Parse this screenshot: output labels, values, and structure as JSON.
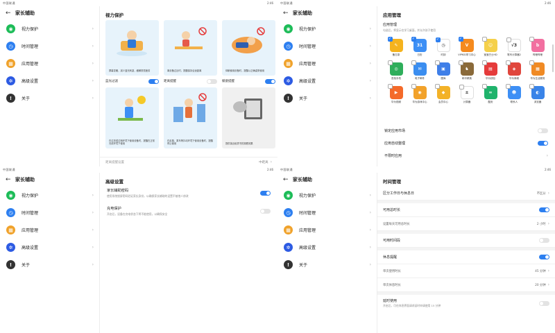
{
  "status": {
    "left": "中国联通",
    "time": "2:46"
  },
  "nav": {
    "header_title": "家长辅助",
    "items": [
      {
        "label": "视力保护",
        "icon": "eye-icon"
      },
      {
        "label": "时间管理",
        "icon": "clock-icon"
      },
      {
        "label": "应用管理",
        "icon": "grid-icon"
      },
      {
        "label": "高级设置",
        "icon": "gear-icon"
      },
      {
        "label": "关于",
        "icon": "info-icon"
      }
    ]
  },
  "vision": {
    "title": "视力保护",
    "cards": [
      {
        "text": "屏幕变暖，减少蓝光刺激，缓解视觉疲劳"
      },
      {
        "text": "离设备过近时，提醒保持合适距离"
      },
      {
        "text": "仰躺使用设备时，提醒以正确姿势使用"
      },
      {
        "text": "在过亮或过暗环境下使用设备时，提醒在正常光线环境下使用"
      },
      {
        "text": "在走路、乘车等抖动环境下使用设备时，提醒停止使用"
      },
      {
        "text": "提供接近纸质书的观看效果"
      }
    ],
    "toggles": [
      {
        "label": "蓝光过滤",
        "on": true
      },
      {
        "label": "距离提醒",
        "on": false
      },
      {
        "label": "躺姿提醒",
        "on": true
      }
    ],
    "distance_setting": {
      "label": "距离提醒设置",
      "value": "中距离"
    }
  },
  "apps": {
    "title": "应用管理",
    "sub_title": "应用管理",
    "sub_desc": "勾选后，将显示在学习桌面，并允许孩子使用",
    "items": [
      {
        "name": "备忘录",
        "color": "#f5b31e",
        "checked": true,
        "glyph": "✎"
      },
      {
        "name": "日历",
        "color": "#3d8ff5",
        "checked": true,
        "glyph": "31"
      },
      {
        "name": "时钟",
        "color": "#ffffff",
        "checked": true,
        "glyph": "◷"
      },
      {
        "name": "VIPKID学习中心",
        "color": "#f58a1e",
        "checked": true,
        "glyph": "V"
      },
      {
        "name": "宝宝巴士HD",
        "color": "#f5d04a",
        "checked": false,
        "glyph": "☺"
      },
      {
        "name": "笔写计算器2",
        "color": "#ffffff",
        "checked": false,
        "glyph": "√3"
      },
      {
        "name": "哔哩哔哩",
        "color": "#f26fa0",
        "checked": false,
        "glyph": "b"
      },
      {
        "name": "查找手机",
        "color": "#2fae5b",
        "checked": false,
        "glyph": "◎"
      },
      {
        "name": "电子邮件",
        "color": "#3b8ef0",
        "checked": false,
        "glyph": "✉"
      },
      {
        "name": "图库",
        "color": "#3f7fe8",
        "checked": false,
        "glyph": "▣"
      },
      {
        "name": "和平精英",
        "color": "#8a6a3a",
        "checked": false,
        "glyph": "♞"
      },
      {
        "name": "华为钱包",
        "color": "#e53b3b",
        "checked": false,
        "glyph": "▤"
      },
      {
        "name": "华为商城",
        "color": "#e0463c",
        "checked": false,
        "glyph": "◈"
      },
      {
        "name": "华为生活服务",
        "color": "#f08a24",
        "checked": false,
        "glyph": "▦"
      },
      {
        "name": "华为视频",
        "color": "#f46a2a",
        "checked": false,
        "glyph": "▶"
      },
      {
        "name": "华为游戏中心",
        "color": "#f2a22a",
        "checked": false,
        "glyph": "◉"
      },
      {
        "name": "会员中心",
        "color": "#f3b228",
        "checked": false,
        "glyph": "◆"
      },
      {
        "name": "计算器",
        "color": "#ffffff",
        "checked": false,
        "glyph": "±"
      },
      {
        "name": "酷安",
        "color": "#1fb36c",
        "checked": false,
        "glyph": "∞"
      },
      {
        "name": "联系人",
        "color": "#3d8ff5",
        "checked": false,
        "glyph": "☻"
      },
      {
        "name": "浏览器",
        "color": "#3a84e8",
        "checked": false,
        "glyph": "◐"
      }
    ],
    "rows": [
      {
        "label": "锁定应用市场",
        "on": false
      },
      {
        "label": "应用自动整理",
        "on": true
      }
    ],
    "unlimited": {
      "label": "不限时应用"
    }
  },
  "advanced": {
    "title": "高级设置",
    "items": [
      {
        "title": "家长辅助密码",
        "desc": "使用系统锁屏密码验证家长身份，以确保家长辅助的设置不被他人修改",
        "on": true
      },
      {
        "title": "充电保护",
        "desc": "开启后，设备在充电状态下将不能使用，以确保安全",
        "on": false
      }
    ]
  },
  "time": {
    "title": "时间管理",
    "workday": {
      "label": "区分工作日与休息日",
      "value": "不区分"
    },
    "usable": {
      "label": "可用总时长",
      "on": true
    },
    "daily": {
      "label": "设置每天可用总时长",
      "value": "2 小时"
    },
    "period": {
      "label": "可用时间段",
      "on": false
    },
    "rest": {
      "label": "休息提醒",
      "on": true
    },
    "single": {
      "label": "单次使用时长",
      "value": "45 分钟"
    },
    "single_rest": {
      "label": "单次休息时长",
      "value": "20 分钟"
    },
    "delay": {
      "label": "延时使用",
      "desc": "开启后，可在休息界面请求延时申请使用 15 分钟",
      "on": false
    }
  },
  "colors": {
    "accent": "#2d7ff0",
    "green": "#1dbc58",
    "orange": "#f0a22b"
  }
}
